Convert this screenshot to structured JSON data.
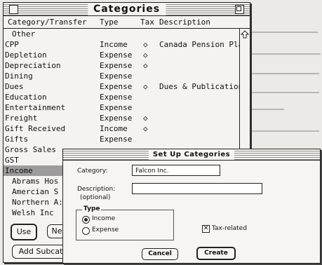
{
  "window": {
    "title": "Categories",
    "columns": [
      "Category/Transfer",
      "Type",
      "Tax",
      "Description"
    ],
    "rows": [
      {
        "name": "Other",
        "type": "",
        "tax": "",
        "description": "",
        "indent": true
      },
      {
        "name": "CPP",
        "type": "Income",
        "tax": "◇",
        "description": "Canada Pension Plan"
      },
      {
        "name": "Depletion",
        "type": "Expense",
        "tax": "◇",
        "description": ""
      },
      {
        "name": "Depreciation",
        "type": "Expense",
        "tax": "◇",
        "description": ""
      },
      {
        "name": "Dining",
        "type": "Expense",
        "tax": "",
        "description": ""
      },
      {
        "name": "Dues",
        "type": "Expense",
        "tax": "◇",
        "description": "Dues & Publications"
      },
      {
        "name": "Education",
        "type": "Expense",
        "tax": "",
        "description": ""
      },
      {
        "name": "Entertainment",
        "type": "Expense",
        "tax": "",
        "description": ""
      },
      {
        "name": "Freight",
        "type": "Expense",
        "tax": "◇",
        "description": ""
      },
      {
        "name": "Gift Received",
        "type": "Income",
        "tax": "◇",
        "description": ""
      },
      {
        "name": "Gifts",
        "type": "Expense",
        "tax": "",
        "description": ""
      },
      {
        "name": "Gross Sales",
        "type": "",
        "tax": "",
        "description": ""
      },
      {
        "name": "GST",
        "type": "",
        "tax": "",
        "description": ""
      },
      {
        "name": "Income",
        "type": "",
        "tax": "",
        "description": "",
        "selected": true
      },
      {
        "name": "Abrams Hos",
        "type": "",
        "tax": "",
        "description": "",
        "indent": true
      },
      {
        "name": "Amercian S",
        "type": "",
        "tax": "",
        "description": "",
        "indent": true
      },
      {
        "name": "Northern A:",
        "type": "",
        "tax": "",
        "description": "",
        "indent": true
      },
      {
        "name": "Welsh Inc",
        "type": "",
        "tax": "",
        "description": "",
        "indent": true
      }
    ],
    "buttons": {
      "use": "Use",
      "new": "Ne",
      "add_subcategory": "Add Subcat"
    }
  },
  "dialog": {
    "title": "Set Up Categories",
    "category_label": "Category:",
    "category_value": "Falcon Inc.",
    "description_label": "Description:",
    "description_sublabel": "(optional)",
    "description_value": "",
    "type_group_label": "Type",
    "radio_income": "Income",
    "radio_expense": "Expense",
    "selected_type": "Income",
    "tax_related_label": "Tax-related",
    "tax_related_checked": true,
    "cancel_label": "Cancel",
    "create_label": "Create"
  }
}
